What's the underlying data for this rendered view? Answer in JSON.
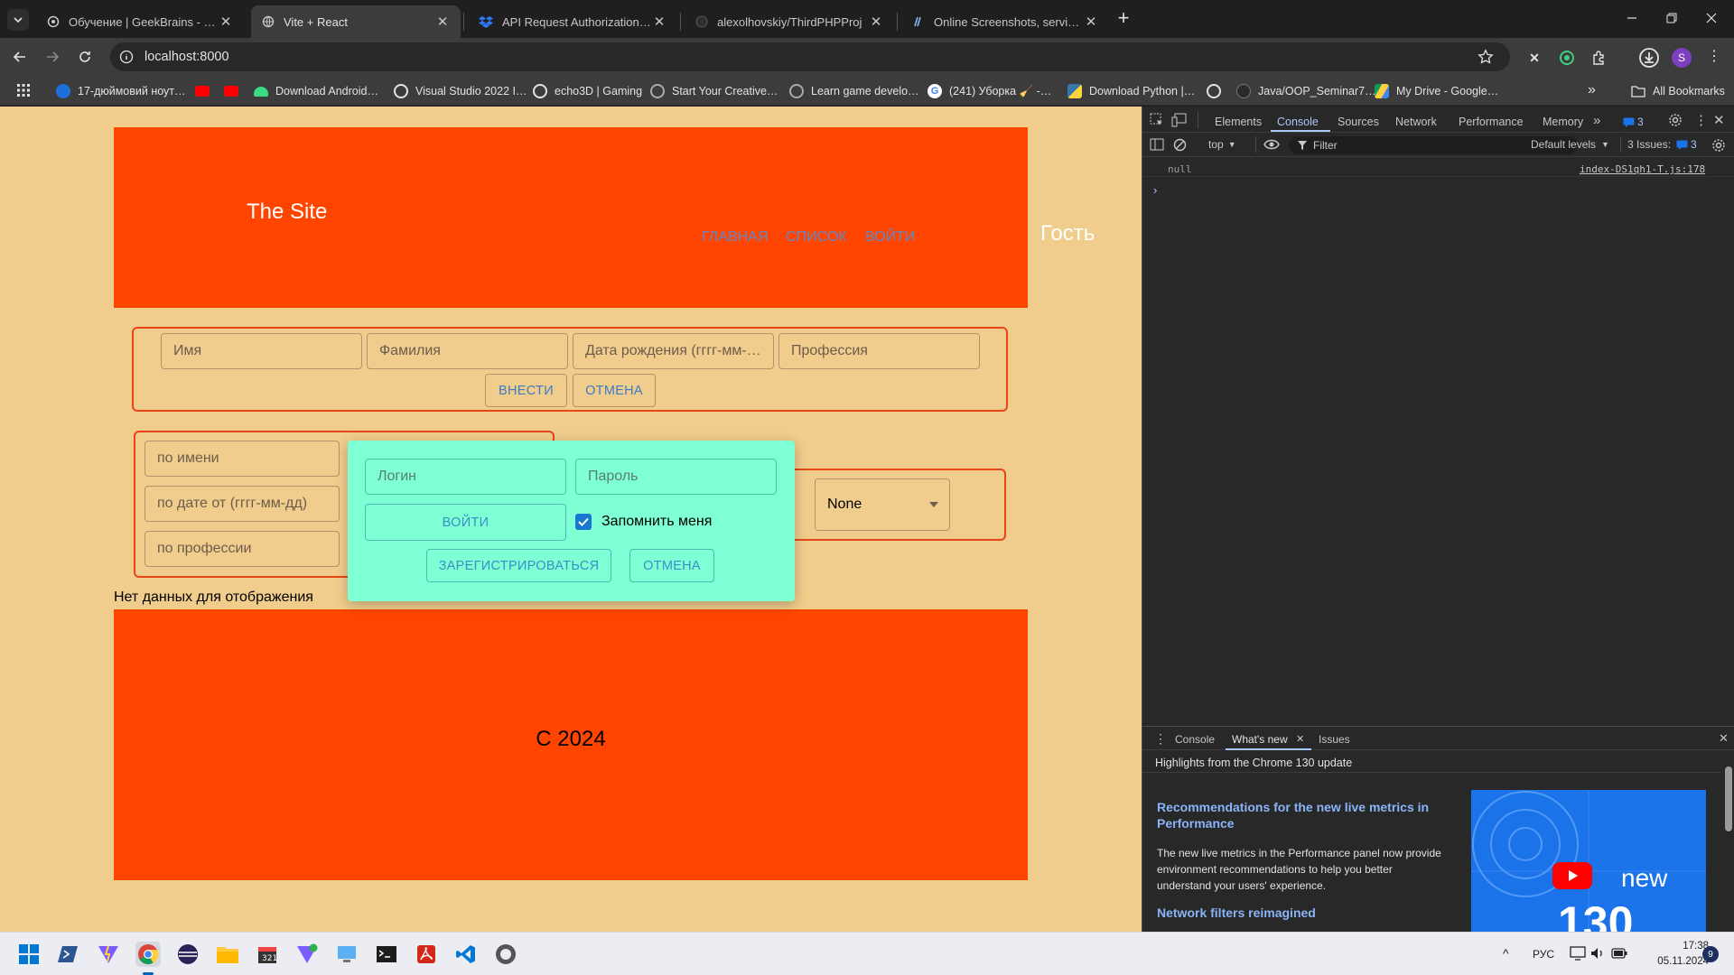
{
  "tabs": [
    {
      "title": "Обучение | GeekBrains - обра…",
      "active": false
    },
    {
      "title": "Vite + React",
      "active": true
    },
    {
      "title": "API Request Authorization - Dr…",
      "active": false
    },
    {
      "title": "alexolhovskiy/ThirdPHPProj",
      "active": false
    },
    {
      "title": "Online Screenshots, service for…",
      "active": false
    }
  ],
  "address": {
    "url": "localhost:8000"
  },
  "bookmarks": [
    {
      "label": "17-дюймовий ноут…",
      "icon": "hp-icon"
    },
    {
      "label": "",
      "icon": "youtube-icon"
    },
    {
      "label": "",
      "icon": "youtube-icon"
    },
    {
      "label": "Download Android…",
      "icon": "android-icon"
    },
    {
      "label": "Visual Studio 2022 I…",
      "icon": "unity-icon"
    },
    {
      "label": "echo3D | Gaming",
      "icon": "echo3d-icon"
    },
    {
      "label": "Start Your Creative…",
      "icon": "unity-icon"
    },
    {
      "label": "Learn game develo…",
      "icon": "unity-icon"
    },
    {
      "label": "(241) Уборка 🧹 -…",
      "icon": "google-icon"
    },
    {
      "label": "Download Python |…",
      "icon": "python-icon"
    },
    {
      "label": "",
      "icon": "openai-icon"
    },
    {
      "label": "Java/OOP_Seminar7…",
      "icon": "github-icon"
    },
    {
      "label": "My Drive - Google…",
      "icon": "drive-icon"
    }
  ],
  "all_bookmarks": "All Bookmarks",
  "site": {
    "title": "The Site",
    "nav": [
      "ГЛАВНАЯ",
      "СПИСОК",
      "ВОЙТИ"
    ],
    "user": "Гость"
  },
  "add_form": {
    "placeholders": [
      "Имя",
      "Фамилия",
      "Дата рождения (гггг-мм-…",
      "Профессия"
    ],
    "submit": "ВНЕСТИ",
    "cancel": "ОТМЕНА"
  },
  "filters": {
    "by_name": "по имени",
    "by_date": "по дате от (гггг-мм-дд)",
    "by_profession": "по профессии",
    "select_value": "None"
  },
  "login_modal": {
    "login_placeholder": "Логин",
    "password_placeholder": "Пароль",
    "login_button": "ВОЙТИ",
    "remember_label": "Запомнить меня",
    "remember_checked": true,
    "register_button": "ЗАРЕГИСТРИРОВАТЬСЯ",
    "cancel_button": "ОТМЕНА"
  },
  "no_data": "Нет данных для отображения",
  "footer": {
    "text": "С 2024"
  },
  "devtools": {
    "tabs": [
      "Elements",
      "Console",
      "Sources",
      "Network",
      "Performance",
      "Memory"
    ],
    "active_tab": "Console",
    "issues_badge": "3",
    "context": "top",
    "filter_placeholder": "Filter",
    "levels": "Default levels",
    "issues_label": "3 Issues:",
    "issues_count": "3",
    "console_output": "null",
    "console_source": "index-DS1qh1-T.js:178",
    "drawer_tabs": [
      "Console",
      "What's new",
      "Issues"
    ],
    "drawer_active": "What's new",
    "whats_new_header": "Highlights from the Chrome 130 update",
    "article1_title": "Recommendations for the new live metrics in Performance",
    "article1_body": "The new live metrics in the Performance panel now provide environment recommendations to help you better understand your users' experience.",
    "article2_title": "Network filters reimagined",
    "thumb_text": "new",
    "thumb_number": "130"
  },
  "taskbar": {
    "language": "РУС",
    "time": "17:38",
    "date": "05.11.2024",
    "notif_count": "9"
  },
  "colors": {
    "page_bg": "#f0cd8c",
    "header_bg": "#ff4500",
    "modal_bg": "#7fffd4",
    "accent_blue": "#3d7bc4"
  }
}
